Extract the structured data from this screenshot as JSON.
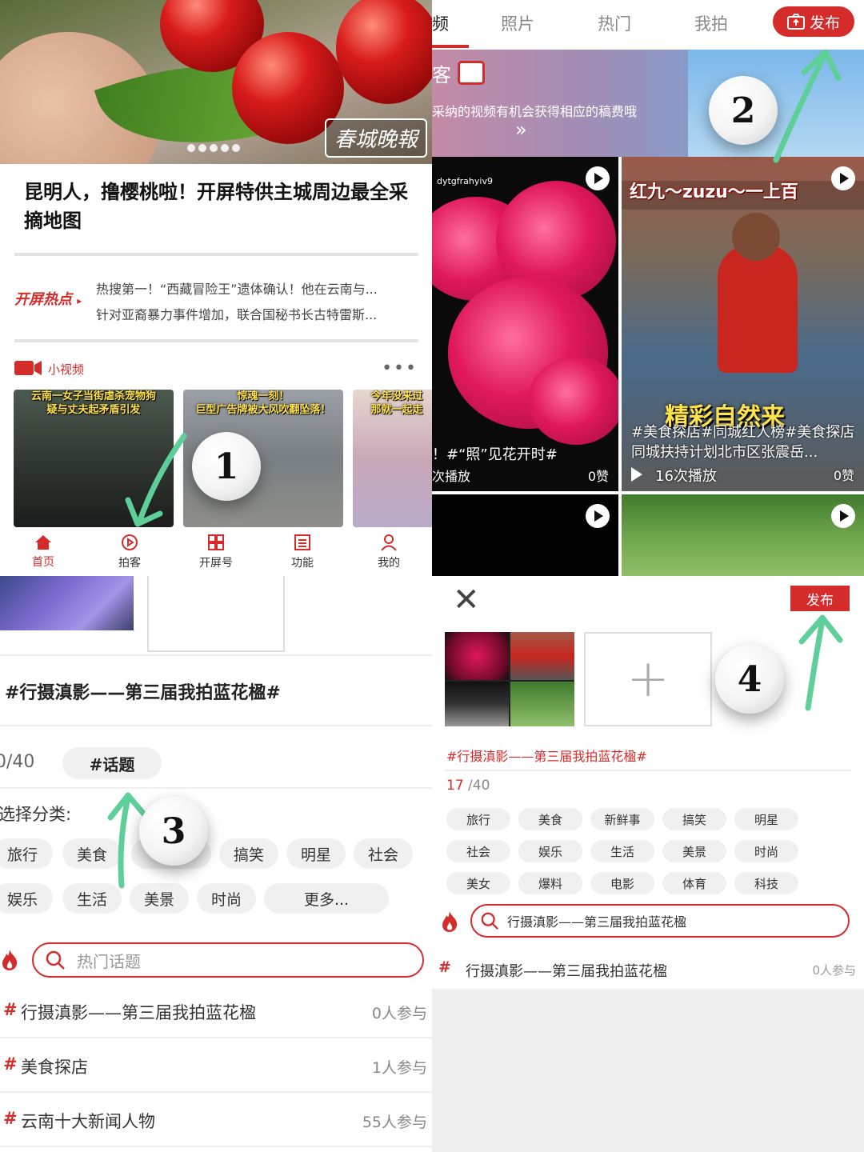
{
  "panel1": {
    "hero_logo": "春城晚報",
    "headline": "昆明人，撸樱桃啦！开屏特供主城周边最全采摘地图",
    "hot_label": "开屏热点",
    "hot_items": [
      "热搜第一！“西藏冒险王”遗体确认！他在云南与...",
      "针对亚裔暴力事件增加，联合国秘书长古特雷斯..."
    ],
    "video_section_label": "小视频",
    "thumbs": [
      {
        "caption": "云南一女子当街虐杀宠物狗\n疑与丈夫起矛盾引发"
      },
      {
        "caption": "惊魂一刻！\n巨型广告牌被大风吹翻坠落！"
      },
      {
        "caption": "今年没来过\n那就一起走"
      }
    ],
    "tabs": [
      "首页",
      "拍客",
      "开屏号",
      "功能",
      "我的"
    ],
    "step": "1"
  },
  "panel2": {
    "nav_items": [
      "频",
      "照片",
      "热门",
      "我拍"
    ],
    "publish_label": "发布",
    "banner_title": "客",
    "banner_sub": "采纳的视频有机会获得相应的稿费哦",
    "banner_chevron": "»",
    "left_card": {
      "user": "dytgfrahyiv9",
      "caption": "！#“照”见花开时#",
      "plays": "次播放",
      "likes": "0赞"
    },
    "right_card": {
      "top_title": "红九～zuzu～一上百",
      "headline": "精彩自然来",
      "caption": "#美食探店#同城红人榜#美食探店同城扶持计划北市区张震岳...",
      "plays": "16次播放",
      "likes": "0赞"
    },
    "step": "2"
  },
  "panel3": {
    "title": "#行摄滇影——第三届我拍蓝花楹#",
    "count": "0/40",
    "topic_button": "#话题",
    "category_label": "选择分类:",
    "chips_row1": [
      "旅行",
      "美食",
      "新",
      "搞笑",
      "明星",
      "社会"
    ],
    "chips_row2": [
      "娱乐",
      "生活",
      "美景",
      "时尚",
      "更多..."
    ],
    "search_placeholder": "热门话题",
    "topics": [
      {
        "name": "行摄滇影——第三届我拍蓝花楹",
        "count": "0人参与"
      },
      {
        "name": "美食探店",
        "count": "1人参与"
      },
      {
        "name": "云南十大新闻人物",
        "count": "55人参与"
      }
    ],
    "step": "3"
  },
  "panel4": {
    "publish_label": "发布",
    "title": "#行摄滇影——第三届我拍蓝花楹#",
    "count_current": "17",
    "count_total": " /40",
    "chips": [
      "旅行",
      "美食",
      "新鲜事",
      "搞笑",
      "明星",
      "社会",
      "娱乐",
      "生活",
      "美景",
      "时尚",
      "美女",
      "爆料",
      "电影",
      "体育",
      "科技"
    ],
    "search_value": "行摄滇影——第三届我拍蓝花楹",
    "result": {
      "name": "行摄滇影——第三届我拍蓝花楹",
      "count": "0人参与"
    },
    "step": "4"
  },
  "colors": {
    "accent": "#d42b2b",
    "arrow": "#5fcf9a"
  }
}
